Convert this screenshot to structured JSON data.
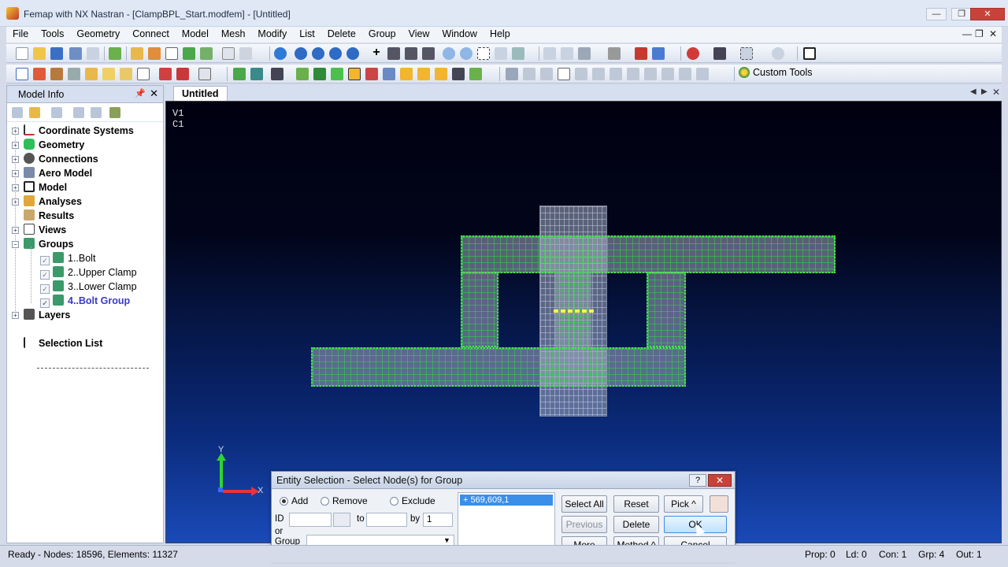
{
  "window": {
    "title": "Femap with NX Nastran - [ClampBPL_Start.modfem] - [Untitled]",
    "minimize": "—",
    "restore": "❐",
    "close": "✕"
  },
  "menu": {
    "items": [
      "File",
      "Tools",
      "Geometry",
      "Connect",
      "Model",
      "Mesh",
      "Modify",
      "List",
      "Delete",
      "Group",
      "View",
      "Window",
      "Help"
    ],
    "mdi_min": "—",
    "mdi_restore": "❐",
    "mdi_close": "✕"
  },
  "toolbar": {
    "custom_tools_label": "Custom Tools"
  },
  "model_info": {
    "title": "Model Info",
    "pin": "📌",
    "close": "✕",
    "tree": [
      {
        "label": "Coordinate Systems"
      },
      {
        "label": "Geometry"
      },
      {
        "label": "Connections"
      },
      {
        "label": "Aero Model"
      },
      {
        "label": "Model"
      },
      {
        "label": "Analyses"
      },
      {
        "label": "Results"
      },
      {
        "label": "Views"
      },
      {
        "label": "Groups"
      },
      {
        "label": "1..Bolt"
      },
      {
        "label": "2..Upper Clamp"
      },
      {
        "label": "3..Lower Clamp"
      },
      {
        "label": "4..Bolt Group"
      },
      {
        "label": "Layers"
      },
      {
        "label": "Selection List"
      }
    ]
  },
  "graphics": {
    "tab_label": "Untitled",
    "view_label": "V1",
    "csys_label": "C1",
    "axis_y": "Y",
    "axis_x": "X",
    "tab_close": "✕"
  },
  "dialog": {
    "title": "Entity Selection - Select Node(s) for Group",
    "help": "?",
    "close": "✕",
    "radio_add": "Add",
    "radio_remove": "Remove",
    "radio_exclude": "Exclude",
    "id_label": "ID",
    "to_label": "to",
    "by_label": "by",
    "by_value": "1",
    "or_label": "or",
    "group_label": "Group",
    "list_entry": "+ 569,609,1",
    "select_all": "Select All",
    "reset": "Reset",
    "pick": "Pick ^",
    "previous": "Previous",
    "delete": "Delete",
    "ok": "OK",
    "more": "More",
    "method": "Method ^",
    "cancel": "Cancel"
  },
  "status": {
    "left": "Ready - Nodes: 18596,  Elements: 11327",
    "prop": "Prop: 0",
    "ld": "Ld: 0",
    "con": "Con: 1",
    "grp": "Grp: 4",
    "out": "Out: 1"
  }
}
